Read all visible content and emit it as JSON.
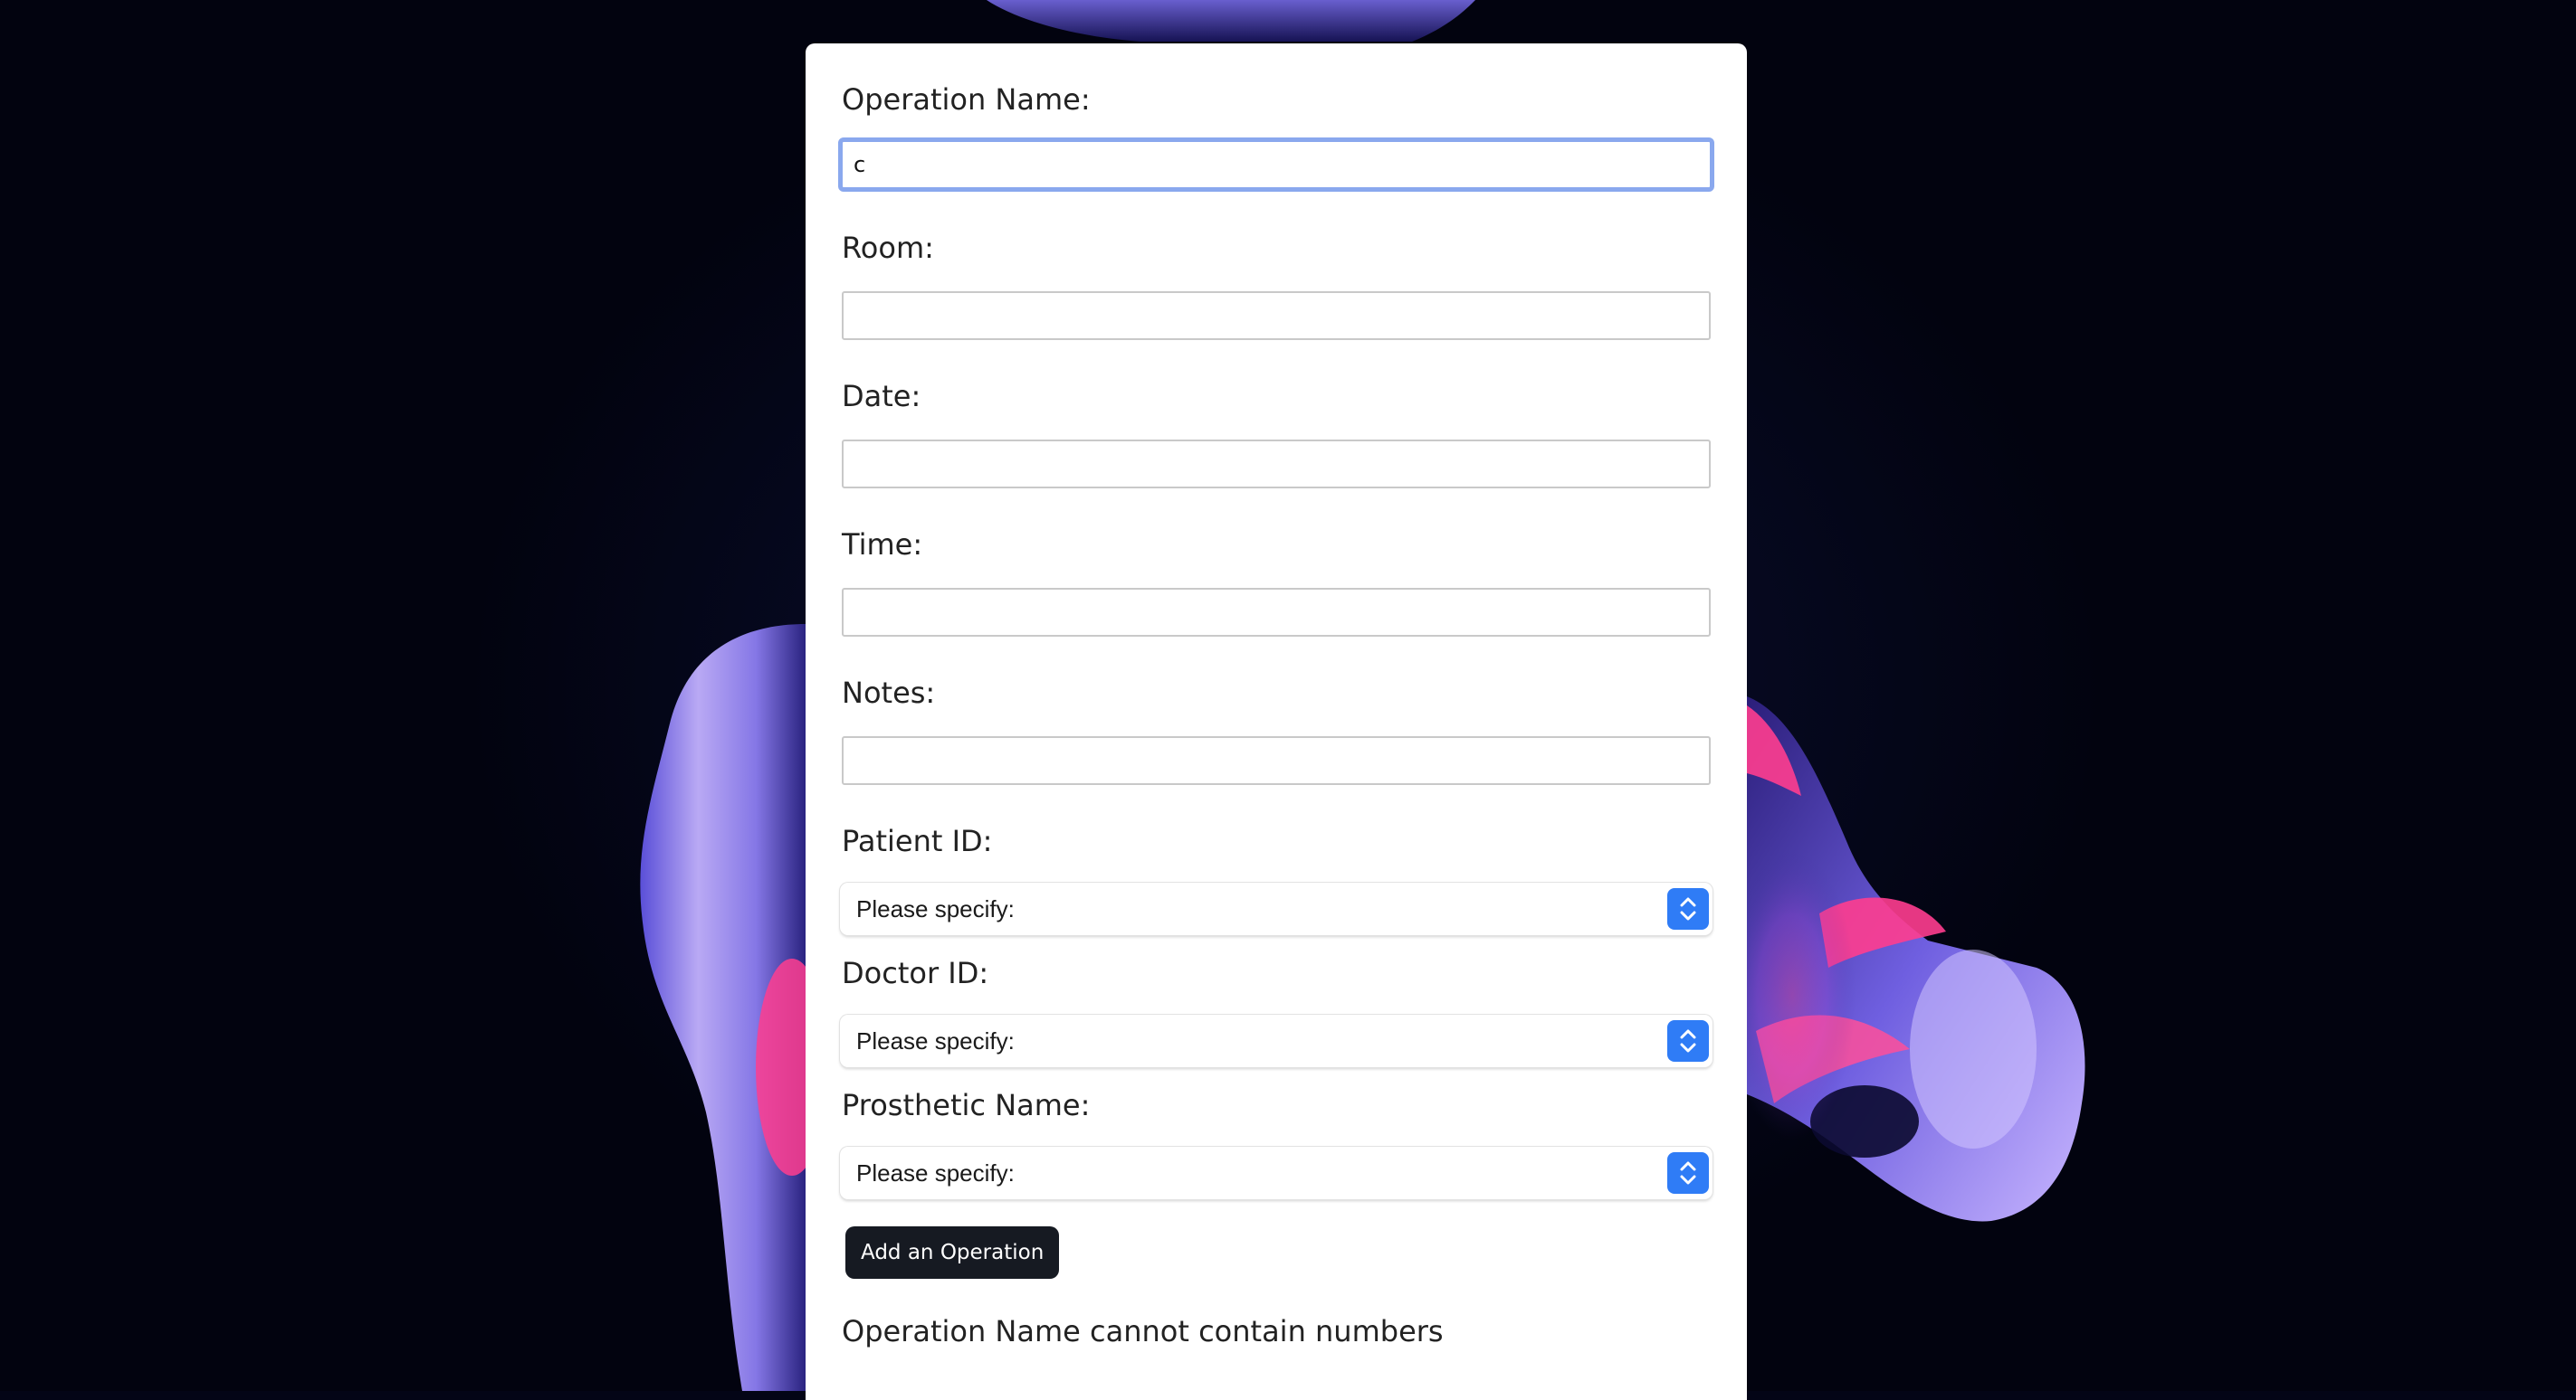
{
  "form": {
    "fields": {
      "operation_name": {
        "label": "Operation Name:",
        "value": "c"
      },
      "room": {
        "label": "Room:",
        "value": ""
      },
      "date": {
        "label": "Date:",
        "value": ""
      },
      "time": {
        "label": "Time:",
        "value": ""
      },
      "notes": {
        "label": "Notes:",
        "value": ""
      },
      "patient_id": {
        "label": "Patient ID:",
        "selected": "Please specify:"
      },
      "doctor_id": {
        "label": "Doctor ID:",
        "selected": "Please specify:"
      },
      "prosthetic_name": {
        "label": "Prosthetic Name:",
        "selected": "Please specify:"
      }
    },
    "submit_label": "Add an Operation",
    "error_message": "Operation Name cannot contain numbers"
  },
  "colors": {
    "background": "#030516",
    "card": "#ffffff",
    "focus_ring": "#8aa8ee",
    "select_arrow": "#2f7cf6",
    "button": "#161a22",
    "accent_pink": "#ff3d8f",
    "accent_violet": "#7a6cf0"
  },
  "icons": {
    "select_arrows": "chevron-up-down-icon"
  }
}
